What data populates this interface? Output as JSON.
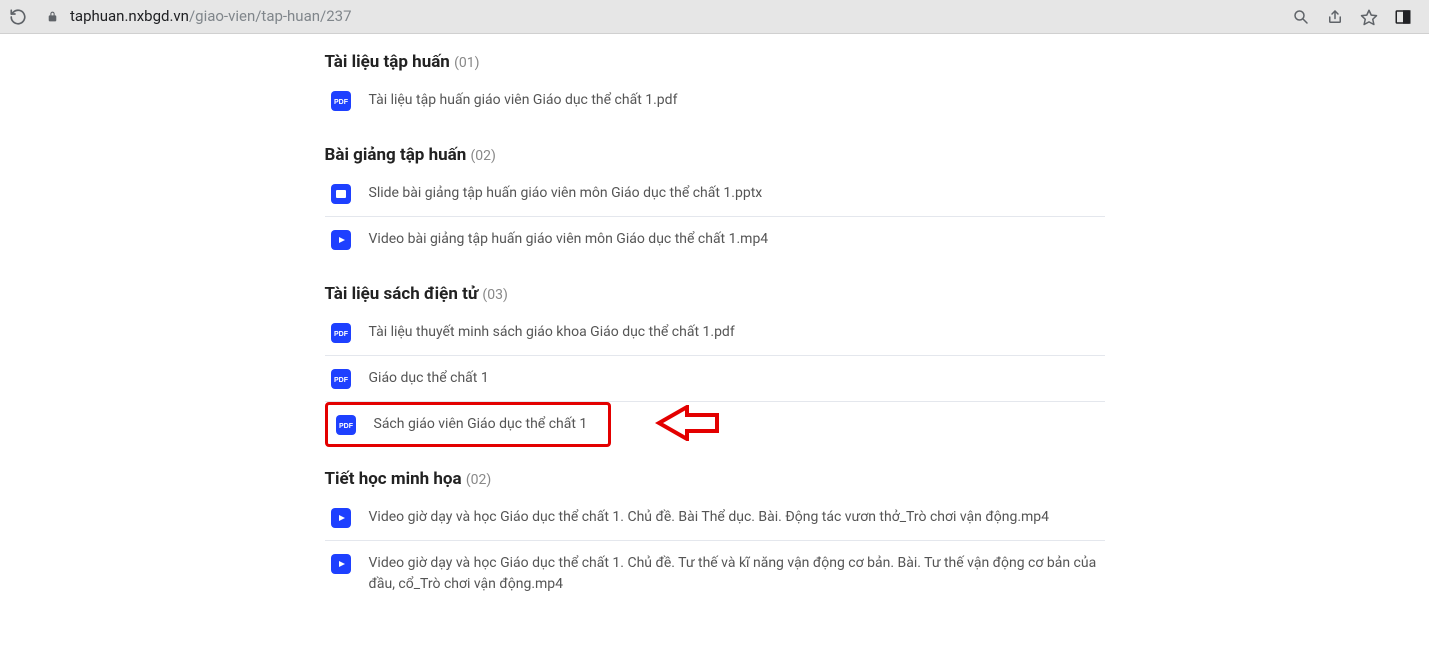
{
  "browser": {
    "url_host": "taphuan.nxbgd.vn",
    "url_path": "/giao-vien/tap-huan/237"
  },
  "sections": [
    {
      "title": "Tài liệu tập huấn",
      "count": "(01)",
      "items": [
        {
          "type": "pdf",
          "label": "Tài liệu tập huấn giáo viên Giáo dục thể chất 1.pdf"
        }
      ]
    },
    {
      "title": "Bài giảng tập huấn",
      "count": "(02)",
      "items": [
        {
          "type": "pptx",
          "label": "Slide bài giảng tập huấn giáo viên môn Giáo dục thể chất 1.pptx"
        },
        {
          "type": "video",
          "label": "Video bài giảng tập huấn giáo viên môn Giáo dục thể chất 1.mp4"
        }
      ]
    },
    {
      "title": "Tài liệu sách điện tử",
      "count": "(03)",
      "items": [
        {
          "type": "pdf",
          "label": "Tài liệu thuyết minh sách giáo khoa Giáo dục thể chất 1.pdf"
        },
        {
          "type": "pdf",
          "label": "Giáo dục thể chất 1"
        },
        {
          "type": "pdf",
          "label": "Sách giáo viên Giáo dục thể chất 1",
          "highlighted": true
        }
      ]
    },
    {
      "title": "Tiết học minh họa",
      "count": "(02)",
      "items": [
        {
          "type": "video",
          "label": "Video giờ dạy và học Giáo dục thể chất 1. Chủ đề. Bài Thể dục. Bài. Động tác vươn thở_Trò chơi vận động.mp4"
        },
        {
          "type": "video",
          "label": "Video giờ dạy và học Giáo dục thể chất 1. Chủ đề. Tư thế và kĩ năng vận động cơ bản. Bài. Tư thế vận động cơ bản của đầu, cổ_Trò chơi vận động.mp4"
        }
      ]
    }
  ]
}
